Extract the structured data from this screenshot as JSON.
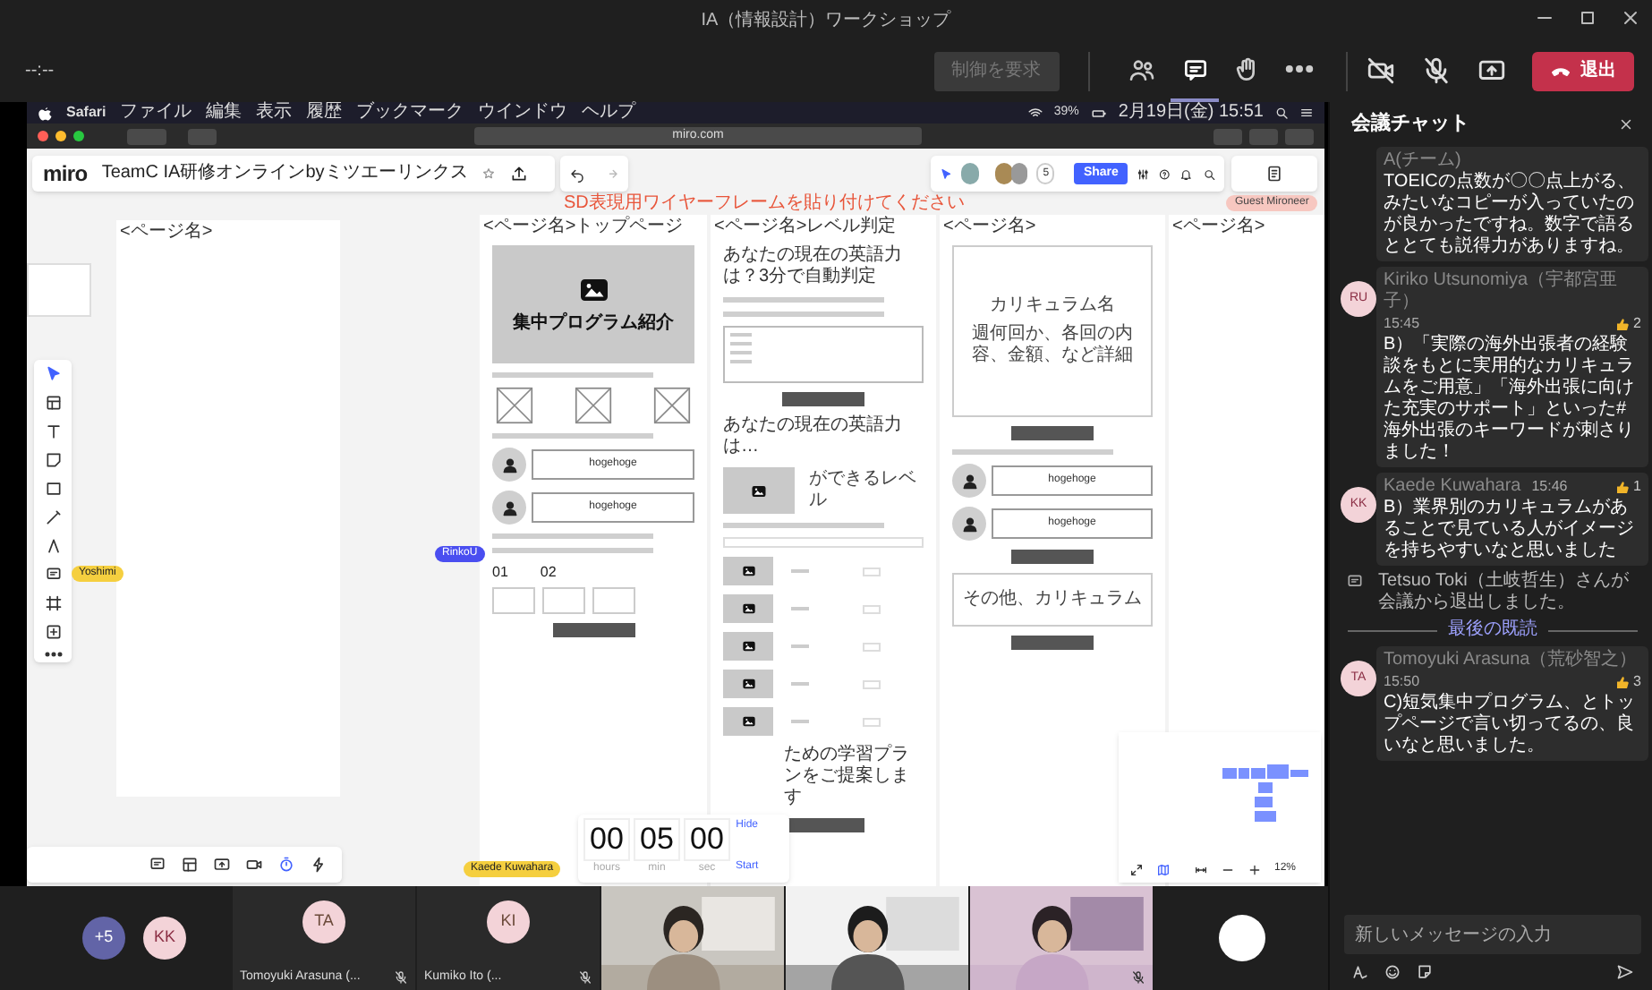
{
  "window": {
    "title": "IA（情報設計）ワークショップ"
  },
  "meeting_toolbar": {
    "timer": "--:--",
    "control_button": {
      "label": "制御を要求",
      "disabled": true
    },
    "tools": [
      {
        "kind": "people",
        "selected": false
      },
      {
        "kind": "chat",
        "selected": true
      },
      {
        "kind": "hand",
        "selected": false
      },
      {
        "kind": "more",
        "selected": false
      }
    ],
    "camera_on": false,
    "mic_on": false,
    "leave_button": "退出"
  },
  "shared_screen": {
    "mac_menu": {
      "app": "Safari",
      "items": [
        "ファイル",
        "編集",
        "表示",
        "履歴",
        "ブックマーク",
        "ウインドウ",
        "ヘルプ"
      ],
      "battery": "39%",
      "clock": "2月19日(金) 15:51"
    },
    "browser": {
      "address": "miro.com"
    },
    "miro": {
      "logo": "miro",
      "board_title": "TeamC IA研修オンラインbyミツエーリンクス",
      "notice": "SD表現用ワイヤーフレームを貼り付けてください",
      "collaborator_count": "5",
      "share_button": "Share",
      "guest_badge": "Guest Mironeer",
      "zoom": "12%",
      "frames": [
        {
          "label": "<ページ名>"
        },
        {
          "label": "<ページ名>トップページ",
          "blocks": [
            {
              "kind": "hero",
              "text": "集中プログラム紹介"
            },
            {
              "kind": "text_line"
            },
            {
              "kind": "placeholder_row"
            },
            {
              "kind": "text_line"
            },
            {
              "kind": "testimonial",
              "text": "hogehoge"
            },
            {
              "kind": "testimonial",
              "text": "hogehoge"
            },
            {
              "kind": "text_line"
            },
            {
              "kind": "text_line"
            },
            {
              "kind": "steps",
              "items": [
                "01",
                "02"
              ]
            },
            {
              "kind": "button"
            }
          ]
        },
        {
          "label": "<ページ名>レベル判定",
          "blocks": [
            {
              "kind": "heading",
              "text": "あなたの現在の英語力は？3分で自動判定"
            },
            {
              "kind": "text_line"
            },
            {
              "kind": "text_line"
            },
            {
              "kind": "form_box"
            },
            {
              "kind": "button"
            },
            {
              "kind": "heading",
              "text": "あなたの現在の英語力は…"
            },
            {
              "kind": "level",
              "text": "ができるレベル"
            },
            {
              "kind": "text_line"
            },
            {
              "kind": "field"
            },
            {
              "kind": "image_row"
            },
            {
              "kind": "image_row"
            },
            {
              "kind": "image_row"
            },
            {
              "kind": "image_row"
            },
            {
              "kind": "image_row"
            },
            {
              "kind": "caption",
              "text": "ための学習プランをご提案します"
            },
            {
              "kind": "button"
            }
          ]
        },
        {
          "label": "<ページ名>",
          "blocks": [
            {
              "kind": "box",
              "texts": [
                "カリキュラム名",
                "週何回か、各回の内容、金額、など詳細"
              ]
            },
            {
              "kind": "button"
            },
            {
              "kind": "text_line"
            },
            {
              "kind": "testimonial",
              "text": "hogehoge"
            },
            {
              "kind": "testimonial",
              "text": "hogehoge"
            },
            {
              "kind": "button"
            },
            {
              "kind": "box",
              "texts": [
                "その他、カリキュラム"
              ]
            },
            {
              "kind": "button"
            }
          ]
        },
        {
          "label": "<ページ名>"
        }
      ],
      "cursors": [
        {
          "name": "Yoshimi",
          "color": "#f5cf3f"
        },
        {
          "name": "RinkoU",
          "color": "#4a4ef0"
        },
        {
          "name": "Kaede Kuwahara",
          "color": "#f5cf3f"
        }
      ],
      "timer": {
        "hours": "00",
        "minutes": "05",
        "seconds": "00",
        "labels": [
          "hours",
          "min",
          "sec"
        ],
        "hide": "Hide",
        "start": "Start"
      }
    }
  },
  "participants": [
    {
      "kind": "overflow",
      "label": "+5"
    },
    {
      "kind": "avatar",
      "initials": "KK"
    },
    {
      "kind": "tile",
      "initials": "TA",
      "name": "Tomoyuki Arasuna (...",
      "muted": true
    },
    {
      "kind": "tile",
      "initials": "KI",
      "name": "Kumiko Ito (...",
      "muted": true
    },
    {
      "kind": "video"
    },
    {
      "kind": "video"
    },
    {
      "kind": "video",
      "muted": true
    },
    {
      "kind": "blank"
    }
  ],
  "chat": {
    "title": "会議チャット",
    "messages": [
      {
        "kind": "message",
        "author": "A(チーム)",
        "text": "TOEICの点数が〇〇点上がる、みたいなコピーが入っていたのが良かったですね。数字で語るととても説得力がありますね。"
      },
      {
        "kind": "message",
        "initials": "RU",
        "author": "Kiriko Utsunomiya（宇都宮亜子）",
        "time": "15:45",
        "likes": "2",
        "text": "B）「実際の海外出張者の経験談をもとに実用的なカリキュラムをご用意」「海外出張に向けた充実のサポート」といった#海外出張のキーワードが刺さりました！"
      },
      {
        "kind": "message",
        "initials": "KK",
        "author": "Kaede Kuwahara",
        "time": "15:46",
        "likes": "1",
        "text": "B）業界別のカリキュラムがあることで見ている人がイメージを持ちやすいなと思いました"
      },
      {
        "kind": "event",
        "text": "Tetsuo Toki（土岐哲生）さんが会議から退出しました。"
      },
      {
        "kind": "divider",
        "text": "最後の既読"
      },
      {
        "kind": "message",
        "initials": "TA",
        "author": "Tomoyuki Arasuna（荒砂智之）",
        "time": "15:50",
        "likes": "3",
        "text": "C)短気集中プログラム、とトップページで言い切ってるの、良いなと思いました。"
      }
    ],
    "input": {
      "placeholder": "新しいメッセージの入力"
    }
  }
}
